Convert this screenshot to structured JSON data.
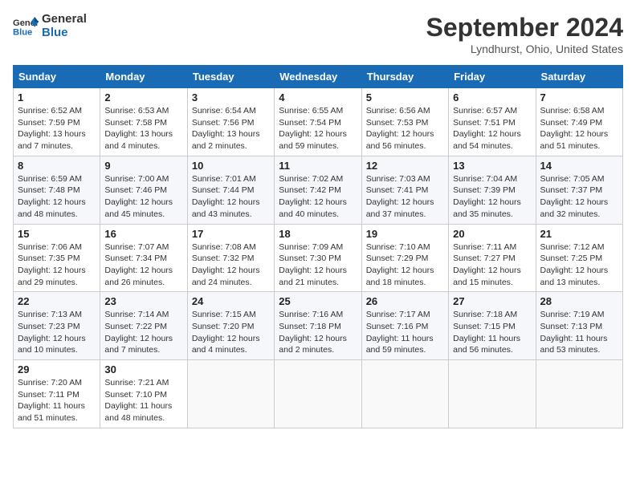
{
  "header": {
    "logo_line1": "General",
    "logo_line2": "Blue",
    "month": "September 2024",
    "location": "Lyndhurst, Ohio, United States"
  },
  "days_of_week": [
    "Sunday",
    "Monday",
    "Tuesday",
    "Wednesday",
    "Thursday",
    "Friday",
    "Saturday"
  ],
  "weeks": [
    [
      {
        "day": "1",
        "sunrise": "6:52 AM",
        "sunset": "7:59 PM",
        "daylight": "13 hours and 7 minutes."
      },
      {
        "day": "2",
        "sunrise": "6:53 AM",
        "sunset": "7:58 PM",
        "daylight": "13 hours and 4 minutes."
      },
      {
        "day": "3",
        "sunrise": "6:54 AM",
        "sunset": "7:56 PM",
        "daylight": "13 hours and 2 minutes."
      },
      {
        "day": "4",
        "sunrise": "6:55 AM",
        "sunset": "7:54 PM",
        "daylight": "12 hours and 59 minutes."
      },
      {
        "day": "5",
        "sunrise": "6:56 AM",
        "sunset": "7:53 PM",
        "daylight": "12 hours and 56 minutes."
      },
      {
        "day": "6",
        "sunrise": "6:57 AM",
        "sunset": "7:51 PM",
        "daylight": "12 hours and 54 minutes."
      },
      {
        "day": "7",
        "sunrise": "6:58 AM",
        "sunset": "7:49 PM",
        "daylight": "12 hours and 51 minutes."
      }
    ],
    [
      {
        "day": "8",
        "sunrise": "6:59 AM",
        "sunset": "7:48 PM",
        "daylight": "12 hours and 48 minutes."
      },
      {
        "day": "9",
        "sunrise": "7:00 AM",
        "sunset": "7:46 PM",
        "daylight": "12 hours and 45 minutes."
      },
      {
        "day": "10",
        "sunrise": "7:01 AM",
        "sunset": "7:44 PM",
        "daylight": "12 hours and 43 minutes."
      },
      {
        "day": "11",
        "sunrise": "7:02 AM",
        "sunset": "7:42 PM",
        "daylight": "12 hours and 40 minutes."
      },
      {
        "day": "12",
        "sunrise": "7:03 AM",
        "sunset": "7:41 PM",
        "daylight": "12 hours and 37 minutes."
      },
      {
        "day": "13",
        "sunrise": "7:04 AM",
        "sunset": "7:39 PM",
        "daylight": "12 hours and 35 minutes."
      },
      {
        "day": "14",
        "sunrise": "7:05 AM",
        "sunset": "7:37 PM",
        "daylight": "12 hours and 32 minutes."
      }
    ],
    [
      {
        "day": "15",
        "sunrise": "7:06 AM",
        "sunset": "7:35 PM",
        "daylight": "12 hours and 29 minutes."
      },
      {
        "day": "16",
        "sunrise": "7:07 AM",
        "sunset": "7:34 PM",
        "daylight": "12 hours and 26 minutes."
      },
      {
        "day": "17",
        "sunrise": "7:08 AM",
        "sunset": "7:32 PM",
        "daylight": "12 hours and 24 minutes."
      },
      {
        "day": "18",
        "sunrise": "7:09 AM",
        "sunset": "7:30 PM",
        "daylight": "12 hours and 21 minutes."
      },
      {
        "day": "19",
        "sunrise": "7:10 AM",
        "sunset": "7:29 PM",
        "daylight": "12 hours and 18 minutes."
      },
      {
        "day": "20",
        "sunrise": "7:11 AM",
        "sunset": "7:27 PM",
        "daylight": "12 hours and 15 minutes."
      },
      {
        "day": "21",
        "sunrise": "7:12 AM",
        "sunset": "7:25 PM",
        "daylight": "12 hours and 13 minutes."
      }
    ],
    [
      {
        "day": "22",
        "sunrise": "7:13 AM",
        "sunset": "7:23 PM",
        "daylight": "12 hours and 10 minutes."
      },
      {
        "day": "23",
        "sunrise": "7:14 AM",
        "sunset": "7:22 PM",
        "daylight": "12 hours and 7 minutes."
      },
      {
        "day": "24",
        "sunrise": "7:15 AM",
        "sunset": "7:20 PM",
        "daylight": "12 hours and 4 minutes."
      },
      {
        "day": "25",
        "sunrise": "7:16 AM",
        "sunset": "7:18 PM",
        "daylight": "12 hours and 2 minutes."
      },
      {
        "day": "26",
        "sunrise": "7:17 AM",
        "sunset": "7:16 PM",
        "daylight": "11 hours and 59 minutes."
      },
      {
        "day": "27",
        "sunrise": "7:18 AM",
        "sunset": "7:15 PM",
        "daylight": "11 hours and 56 minutes."
      },
      {
        "day": "28",
        "sunrise": "7:19 AM",
        "sunset": "7:13 PM",
        "daylight": "11 hours and 53 minutes."
      }
    ],
    [
      {
        "day": "29",
        "sunrise": "7:20 AM",
        "sunset": "7:11 PM",
        "daylight": "11 hours and 51 minutes."
      },
      {
        "day": "30",
        "sunrise": "7:21 AM",
        "sunset": "7:10 PM",
        "daylight": "11 hours and 48 minutes."
      },
      null,
      null,
      null,
      null,
      null
    ]
  ]
}
